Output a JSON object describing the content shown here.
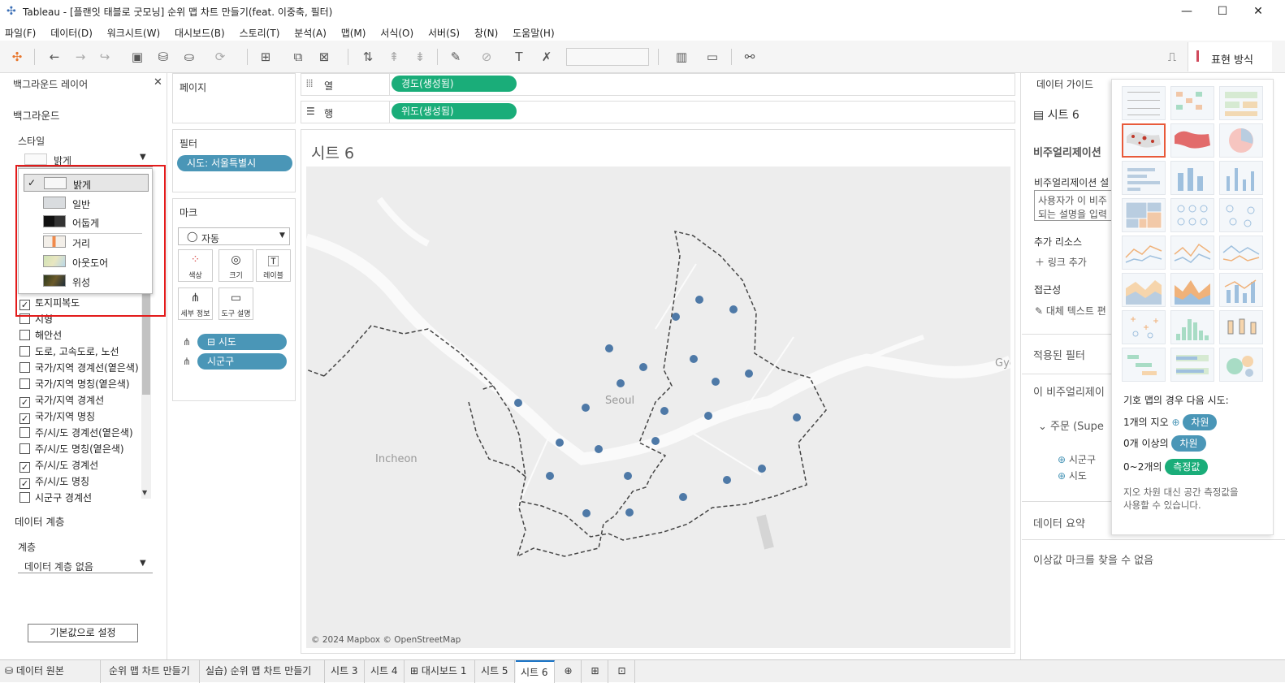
{
  "window": {
    "title": "Tableau - [플랜잇 태블로 굿모닝] 순위 맵 차트 만들기(feat. 이중축, 필터)"
  },
  "menu": [
    "파일(F)",
    "데이터(D)",
    "워크시트(W)",
    "대시보드(B)",
    "스토리(T)",
    "분석(A)",
    "맵(M)",
    "서식(O)",
    "서버(S)",
    "창(N)",
    "도움말(H)"
  ],
  "toolbar": {
    "show_me_label": "표현 방식"
  },
  "left_panel": {
    "title": "백그라운드 레이어",
    "background_header": "백그라운드",
    "style_label": "스타일",
    "style_selected": "밝게",
    "style_options": [
      "밝게",
      "일반",
      "어둡게",
      "거리",
      "아웃도어",
      "위성"
    ],
    "layers": [
      {
        "label": "토지피복도",
        "checked": true
      },
      {
        "label": "지형",
        "checked": false
      },
      {
        "label": "해안선",
        "checked": false
      },
      {
        "label": "도로, 고속도로, 노선",
        "checked": false
      },
      {
        "label": "국가/지역 경계선(옅은색)",
        "checked": false
      },
      {
        "label": "국가/지역 명칭(옅은색)",
        "checked": false
      },
      {
        "label": "국가/지역 경계선",
        "checked": true
      },
      {
        "label": "국가/지역 명칭",
        "checked": true
      },
      {
        "label": "주/시/도 경계선(옅은색)",
        "checked": false
      },
      {
        "label": "주/시/도 명칭(옅은색)",
        "checked": false
      },
      {
        "label": "주/시/도 경계선",
        "checked": true
      },
      {
        "label": "주/시/도 명칭",
        "checked": true
      },
      {
        "label": "시군구 경계선",
        "checked": false
      }
    ],
    "data_layer_header": "데이터 계층",
    "layer_label": "계층",
    "layer_selected": "데이터 계층 없음",
    "default_button": "기본값으로 설정"
  },
  "pages": {
    "title": "페이지"
  },
  "filters": {
    "title": "필터",
    "items": [
      "시도: 서울특별시"
    ]
  },
  "marks": {
    "title": "마크",
    "type": "자동",
    "buttons": [
      "색상",
      "크기",
      "레이블",
      "세부 정보",
      "도구 설명"
    ],
    "fields": [
      "시도",
      "시군구"
    ]
  },
  "shelves": {
    "columns_label": "열",
    "columns_pill": "경도(생성됨)",
    "rows_label": "행",
    "rows_pill": "위도(생성됨)"
  },
  "viz": {
    "sheet_title": "시트 6",
    "labels": {
      "seoul": "Seoul",
      "incheon": "Incheon",
      "gyeo": "Gyeo"
    },
    "attribution": "© 2024 Mapbox © OpenStreetMap"
  },
  "data_guide": {
    "tab": "데이터 가이드",
    "sheet": "시트 6",
    "viz_header": "비주얼리제이션",
    "viz_desc_label": "비주얼리제이션 설",
    "viz_desc_line1": "사용자가 이 비주",
    "viz_desc_line2": "되는 설명을 입력",
    "resources": "추가 리소스",
    "add_link": "링크 추가",
    "access": "접근성",
    "alt_text": "대체 텍스트 편",
    "applied_filters": "적용된 필터",
    "this_viz": "이 비주얼리제이",
    "order_label": "주문 (Supe",
    "field1": "시군구",
    "field2": "시도",
    "data_summary": "데이터 요약",
    "outliers": "이상값 마크를 찾을 수 없음"
  },
  "show_me": {
    "hint": "기호 맵의 경우 다음 시도:",
    "r1_pre": "1개의 지오",
    "r1_tag": "차원",
    "r2_pre": "0개 이상의",
    "r2_tag": "차원",
    "r3_pre": "0~2개의",
    "r3_tag": "측정값",
    "note1": "지오 차원 대신 공간 측정값을",
    "note2": "사용할 수 있습니다."
  },
  "tabs": [
    "데이터 원본",
    "순위 맵 차트 만들기",
    "실습) 순위 맵 차트 만들기",
    "시트 3",
    "시트 4",
    "대시보드 1",
    "시트 5",
    "시트 6"
  ],
  "colors": {
    "accent_blue": "#4a96b7",
    "green_pill": "#1aad79",
    "map_dot": "#4e79a7",
    "highlight": "#e31b1b"
  }
}
